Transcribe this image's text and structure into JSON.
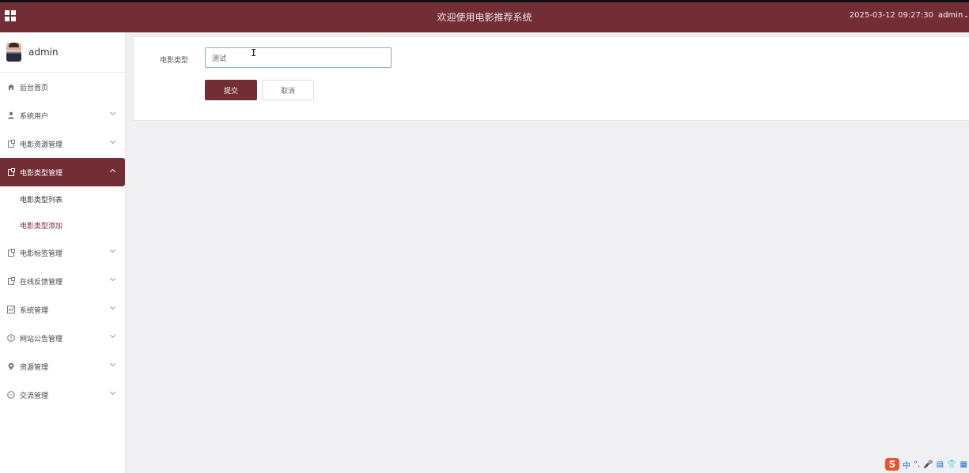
{
  "header": {
    "title": "欢迎使用电影推荐系统",
    "datetime": "2025-03-12 09:27:30",
    "user": "admin",
    "caret": "⌄"
  },
  "sidebar": {
    "profile_name": "admin",
    "items": [
      {
        "label": "后台首页",
        "icon": "home-icon"
      },
      {
        "label": "系统用户",
        "icon": "user-icon"
      },
      {
        "label": "电影资源管理",
        "icon": "doc-icon"
      },
      {
        "label": "电影类型管理",
        "icon": "doc-icon",
        "active": true
      },
      {
        "label": "电影标签管理",
        "icon": "doc-icon"
      },
      {
        "label": "在线反馈管理",
        "icon": "doc-icon"
      },
      {
        "label": "系统管理",
        "icon": "chart-icon"
      },
      {
        "label": "网站公告管理",
        "icon": "info-icon"
      },
      {
        "label": "资源管理",
        "icon": "pin-icon"
      },
      {
        "label": "交流管理",
        "icon": "chat-icon"
      }
    ],
    "subitems": [
      {
        "label": "电影类型列表"
      },
      {
        "label": "电影类型添加",
        "current": true
      }
    ]
  },
  "form": {
    "label": "电影类型",
    "input_value": "测试",
    "submit_label": "提交",
    "cancel_label": "取消"
  },
  "ime": {
    "logo": "S",
    "items": [
      "中",
      "°,",
      "🎤",
      "▤",
      "👕",
      "▦"
    ]
  },
  "colors": {
    "brand": "#722d35",
    "input_border": "#7fb2d6"
  }
}
